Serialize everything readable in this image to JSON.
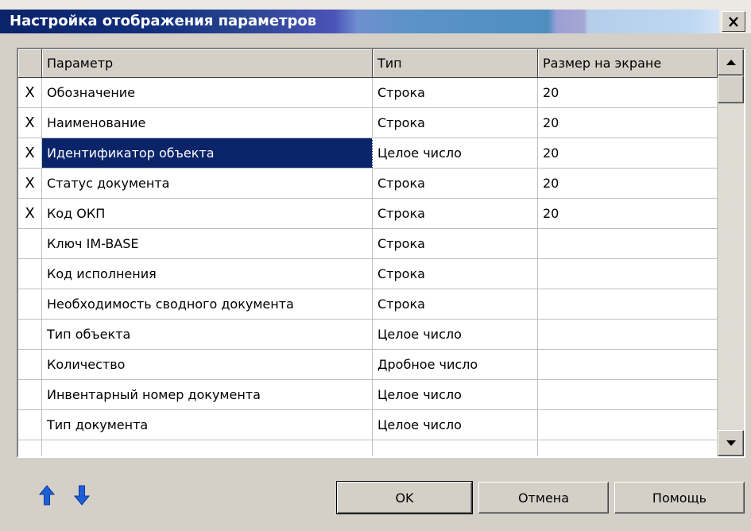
{
  "window": {
    "title": "Настройка отображения параметров",
    "close_label": "×"
  },
  "grid": {
    "columns": [
      "",
      "Параметр",
      "Тип",
      "Размер на экране"
    ],
    "rows": [
      {
        "mark": "X",
        "param": "Обозначение",
        "type": "Строка",
        "size": "20"
      },
      {
        "mark": "X",
        "param": "Наименование",
        "type": "Строка",
        "size": "20"
      },
      {
        "mark": "X",
        "param": "Идентификатор объекта",
        "type": "Целое число",
        "size": "20",
        "selected": true
      },
      {
        "mark": "X",
        "param": "Статус документа",
        "type": "Строка",
        "size": "20"
      },
      {
        "mark": "X",
        "param": "Код ОКП",
        "type": "Строка",
        "size": "20"
      },
      {
        "mark": "",
        "param": "Ключ IM-BASE",
        "type": "Строка",
        "size": ""
      },
      {
        "mark": "",
        "param": "Код исполнения",
        "type": "Строка",
        "size": ""
      },
      {
        "mark": "",
        "param": "Необходимость сводного документа",
        "type": "Строка",
        "size": ""
      },
      {
        "mark": "",
        "param": "Тип объекта",
        "type": "Целое число",
        "size": ""
      },
      {
        "mark": "",
        "param": "Количество",
        "type": "Дробное число",
        "size": ""
      },
      {
        "mark": "",
        "param": "Инвентарный номер документа",
        "type": "Целое число",
        "size": ""
      },
      {
        "mark": "",
        "param": "Тип документа",
        "type": "Целое число",
        "size": ""
      },
      {
        "mark": "",
        "param": "",
        "type": "",
        "size": ""
      }
    ]
  },
  "buttons": {
    "ok": "OK",
    "cancel": "Отмена",
    "help": "Помощь"
  },
  "icons": {
    "move_up": "arrow-up-icon",
    "move_down": "arrow-down-icon"
  },
  "colors": {
    "title_bar": "#0a246a",
    "selection": "#0a246a",
    "arrow": "#1f5fd6",
    "face": "#d4d0c8"
  }
}
